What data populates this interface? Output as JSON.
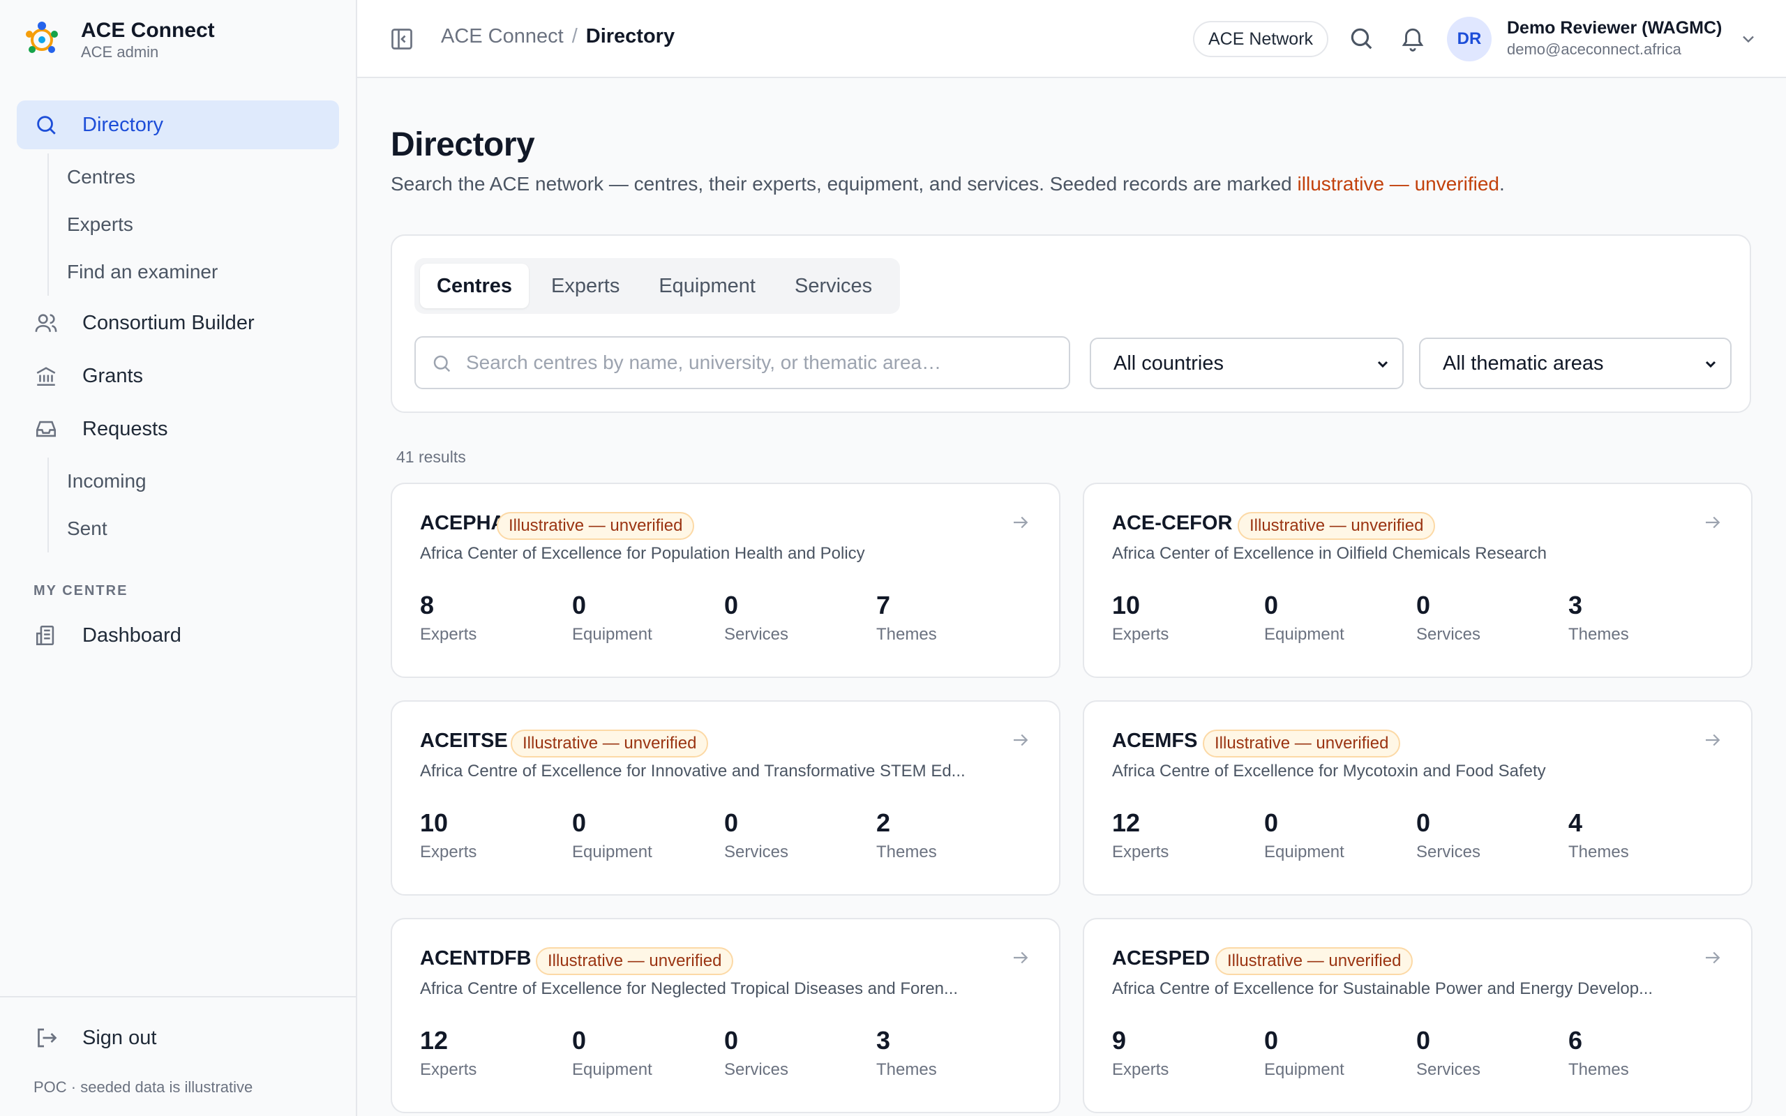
{
  "brand": {
    "title": "ACE Connect",
    "subtitle": "ACE admin"
  },
  "sidebar": {
    "items": [
      {
        "label": "Directory",
        "icon": "search-icon",
        "active": true
      },
      {
        "label": "Consortium Builder",
        "icon": "users-icon"
      },
      {
        "label": "Grants",
        "icon": "bank-icon"
      },
      {
        "label": "Requests",
        "icon": "inbox-icon"
      }
    ],
    "directory_sub": [
      "Centres",
      "Experts",
      "Find an examiner"
    ],
    "requests_sub": [
      "Incoming",
      "Sent"
    ],
    "section_label": "MY CENTRE",
    "dashboard": {
      "label": "Dashboard",
      "icon": "building-icon"
    },
    "signout": "Sign out",
    "footer_note": "POC · seeded data is illustrative"
  },
  "header": {
    "breadcrumb_root": "ACE Connect",
    "breadcrumb_sep": "/",
    "breadcrumb_current": "Directory",
    "network": "ACE Network",
    "user": {
      "initials": "DR",
      "name": "Demo Reviewer (WAGMC)",
      "email": "demo@aceconnect.africa"
    }
  },
  "page": {
    "title": "Directory",
    "desc_prefix": "Search the ACE network — centres, their experts, equipment, and services. Seeded records are marked ",
    "desc_highlight": "illustrative — unverified",
    "desc_suffix": ".",
    "tabs": [
      "Centres",
      "Experts",
      "Equipment",
      "Services"
    ],
    "search_placeholder": "Search centres by name, university, or thematic area…",
    "country_select": "All countries",
    "theme_select": "All thematic areas",
    "results": "41 results"
  },
  "labels": {
    "experts": "Experts",
    "equipment": "Equipment",
    "services": "Services",
    "themes": "Themes",
    "badge": "Illustrative — unverified"
  },
  "centres": [
    {
      "code": "ACEPHAP",
      "name": "Africa Center of Excellence for Population Health and Policy",
      "experts": "8",
      "equipment": "0",
      "services": "0",
      "themes": "7"
    },
    {
      "code": "ACE-CEFOR",
      "name": "Africa Center of Excellence in Oilfield Chemicals Research",
      "experts": "10",
      "equipment": "0",
      "services": "0",
      "themes": "3"
    },
    {
      "code": "ACEITSE",
      "name": "Africa Centre of Excellence for Innovative and Transformative STEM Ed...",
      "experts": "10",
      "equipment": "0",
      "services": "0",
      "themes": "2"
    },
    {
      "code": "ACEMFS",
      "name": "Africa Centre of Excellence for Mycotoxin and Food Safety",
      "experts": "12",
      "equipment": "0",
      "services": "0",
      "themes": "4"
    },
    {
      "code": "ACENTDFB",
      "name": "Africa Centre of Excellence for Neglected Tropical Diseases and Foren...",
      "experts": "12",
      "equipment": "0",
      "services": "0",
      "themes": "3"
    },
    {
      "code": "ACESPED",
      "name": "Africa Centre of Excellence for Sustainable Power and Energy Develop...",
      "experts": "9",
      "equipment": "0",
      "services": "0",
      "themes": "6"
    }
  ],
  "colors": {
    "accent": "#1d4ed8",
    "active_bg": "#dfeafc",
    "warning": "#c2410c",
    "badge_bg": "#fff7e6"
  }
}
